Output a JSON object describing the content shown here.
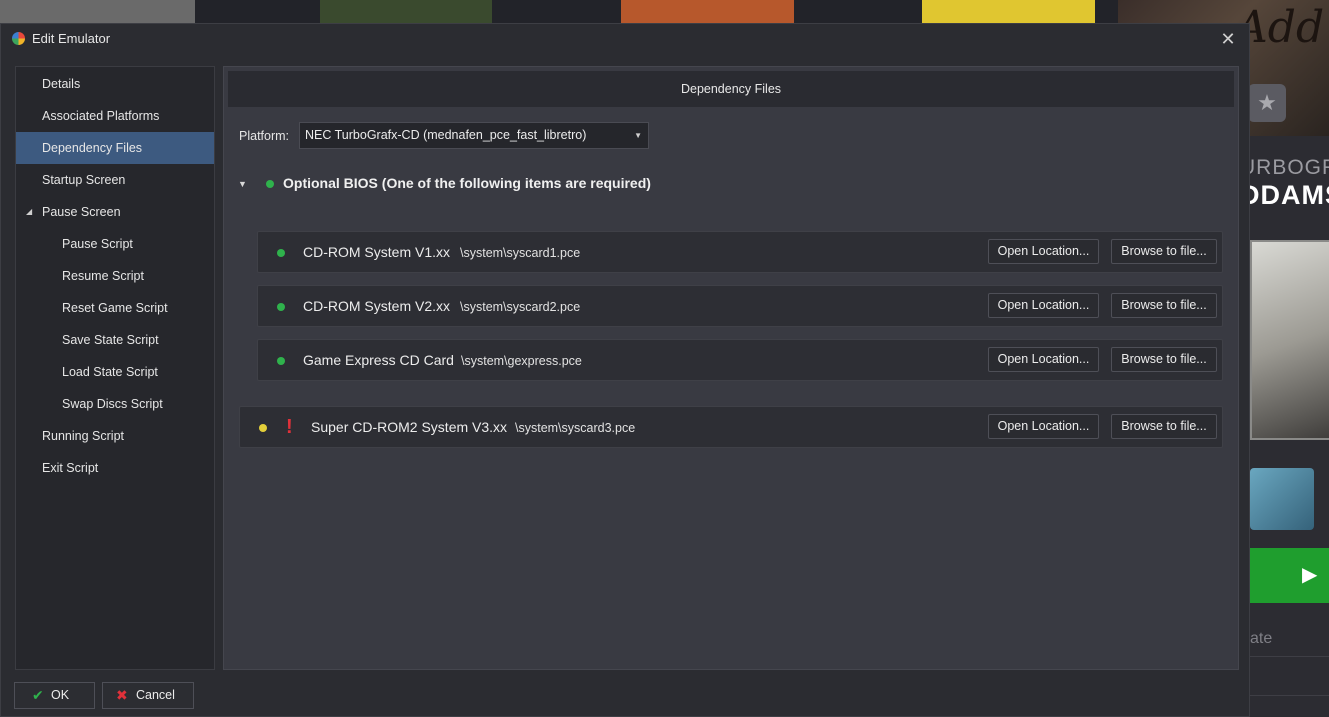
{
  "background": {
    "covers": [
      {
        "color": "#6a6a6a"
      },
      {
        "color": "#3a4a2e"
      },
      {
        "color": "#b7582c"
      },
      {
        "color": "#e0c630"
      }
    ],
    "right_panel": {
      "hero_title": "Add",
      "platform_fragment": "URBOGRA",
      "game_fragment": "DDAMS",
      "rate_fragment": "ate",
      "star_icon": "star-icon",
      "play_icon": "play-icon"
    }
  },
  "dialog": {
    "title": "Edit Emulator",
    "title_icon": "launchbox-icon",
    "close_label": "✕"
  },
  "sidebar": {
    "items": [
      {
        "label": "Details",
        "level": 0,
        "selected": false
      },
      {
        "label": "Associated Platforms",
        "level": 0,
        "selected": false
      },
      {
        "label": "Dependency Files",
        "level": 0,
        "selected": true
      },
      {
        "label": "Startup Screen",
        "level": 0,
        "selected": false
      },
      {
        "label": "Pause Screen",
        "level": 0,
        "selected": false,
        "expanded": true
      },
      {
        "label": "Pause Script",
        "level": 1,
        "selected": false
      },
      {
        "label": "Resume Script",
        "level": 1,
        "selected": false
      },
      {
        "label": "Reset Game Script",
        "level": 1,
        "selected": false
      },
      {
        "label": "Save State Script",
        "level": 1,
        "selected": false
      },
      {
        "label": "Load State Script",
        "level": 1,
        "selected": false
      },
      {
        "label": "Swap Discs Script",
        "level": 1,
        "selected": false
      },
      {
        "label": "Running Script",
        "level": 0,
        "selected": false
      },
      {
        "label": "Exit Script",
        "level": 0,
        "selected": false
      }
    ]
  },
  "content": {
    "header": "Dependency Files",
    "platform_label": "Platform:",
    "platform_value": "NEC TurboGrafx-CD (mednafen_pce_fast_libretro)",
    "group": {
      "title": "Optional BIOS (One of the following items are required)",
      "status": "green",
      "items": [
        {
          "name": "CD-ROM System V1.xx",
          "path": "\\system\\syscard1.pce",
          "status": "green"
        },
        {
          "name": "CD-ROM System V2.xx",
          "path": "\\system\\syscard2.pce",
          "status": "green"
        },
        {
          "name": "Game Express CD Card",
          "path": "\\system\\gexpress.pce",
          "status": "green"
        }
      ]
    },
    "standalone": {
      "name": "Super CD-ROM2 System V3.xx",
      "path": "\\system\\syscard3.pce",
      "status": "yellow",
      "warning": "!"
    },
    "open_location_label": "Open Location...",
    "browse_label": "Browse to file..."
  },
  "footer": {
    "ok_label": "OK",
    "cancel_label": "Cancel"
  },
  "colors": {
    "selected": "#3d5a80",
    "ok_green": "#2fb24c",
    "warn_yellow": "#e3cf3a",
    "error_red": "#e0313a"
  }
}
